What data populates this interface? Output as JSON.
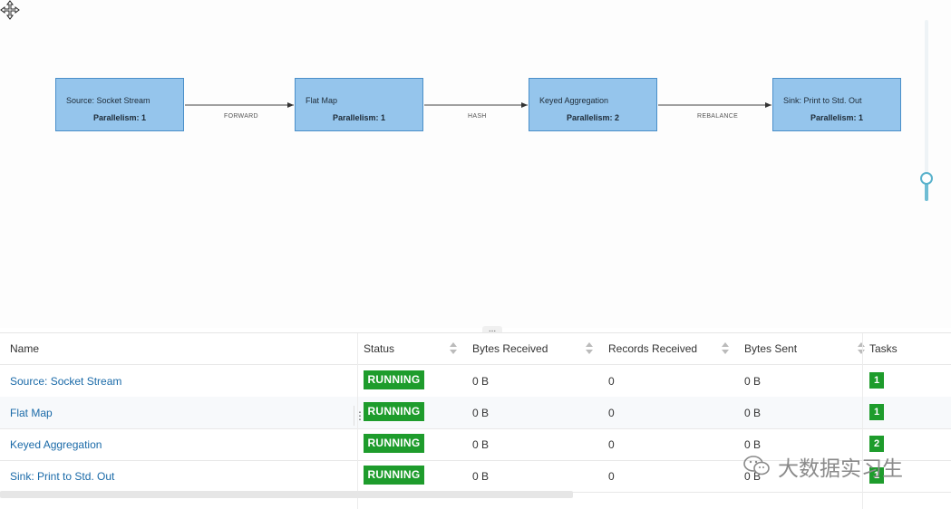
{
  "graph": {
    "nodes": [
      {
        "name": "Source: Socket Stream",
        "parallelism": "Parallelism: 1"
      },
      {
        "name": "Flat Map",
        "parallelism": "Parallelism: 1"
      },
      {
        "name": "Keyed Aggregation",
        "parallelism": "Parallelism: 2"
      },
      {
        "name": "Sink: Print to Std. Out",
        "parallelism": "Parallelism: 1"
      }
    ],
    "edges": [
      "FORWARD",
      "HASH",
      "REBALANCE"
    ],
    "handle_label": "..."
  },
  "table": {
    "columns": [
      "Name",
      "Status",
      "Bytes Received",
      "Records Received",
      "Bytes Sent",
      "Tasks"
    ],
    "rows": [
      {
        "name": "Source: Socket Stream",
        "status": "RUNNING",
        "bytes_received": "0 B",
        "records_received": "0",
        "bytes_sent": "0 B",
        "tasks": "1"
      },
      {
        "name": "Flat Map",
        "status": "RUNNING",
        "bytes_received": "0 B",
        "records_received": "0",
        "bytes_sent": "0 B",
        "tasks": "1"
      },
      {
        "name": "Keyed Aggregation",
        "status": "RUNNING",
        "bytes_received": "0 B",
        "records_received": "0",
        "bytes_sent": "0 B",
        "tasks": "2"
      },
      {
        "name": "Sink: Print to Std. Out",
        "status": "RUNNING",
        "bytes_received": "0 B",
        "records_received": "0",
        "bytes_sent": "0 B",
        "tasks": "1"
      }
    ],
    "column_resize_glyph": "⋮"
  },
  "watermark": {
    "text": "大数据实习生"
  },
  "colors": {
    "node_fill": "#95c5ec",
    "node_border": "#4a8fc9",
    "status_running": "#1e9c2c",
    "link": "#1a6aa8"
  },
  "icons": [
    "move-cursor-icon",
    "sort-icon",
    "zoom-slider-knob",
    "wechat-icon"
  ]
}
